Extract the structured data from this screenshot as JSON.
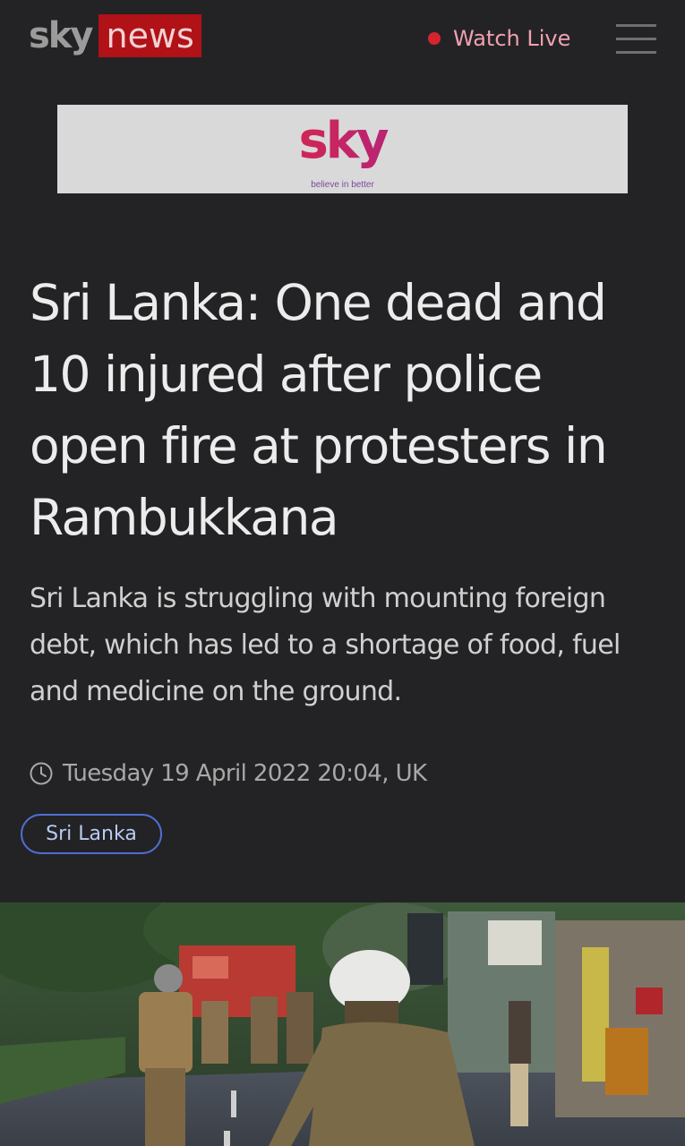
{
  "header": {
    "logo_sky": "sky",
    "logo_news": "news",
    "watch_live_label": "Watch Live",
    "menu_icon": "hamburger-menu-icon",
    "live_dot_color": "#d4252f"
  },
  "ad": {
    "brand": "sky",
    "tagline": "believe in better"
  },
  "article": {
    "headline": "Sri Lanka: One dead and 10 injured after police open fire at protesters in Rambukkana",
    "standfirst": "Sri Lanka is struggling with mounting foreign debt, which has led to a shortage of food, fuel and medicine on the ground.",
    "timestamp": "Tuesday 19 April 2022 20:04, UK",
    "tag": "Sri Lanka",
    "tag_color": "#4d6fd2"
  },
  "hero_image": {
    "description_icon": "photo-police-street-image"
  }
}
